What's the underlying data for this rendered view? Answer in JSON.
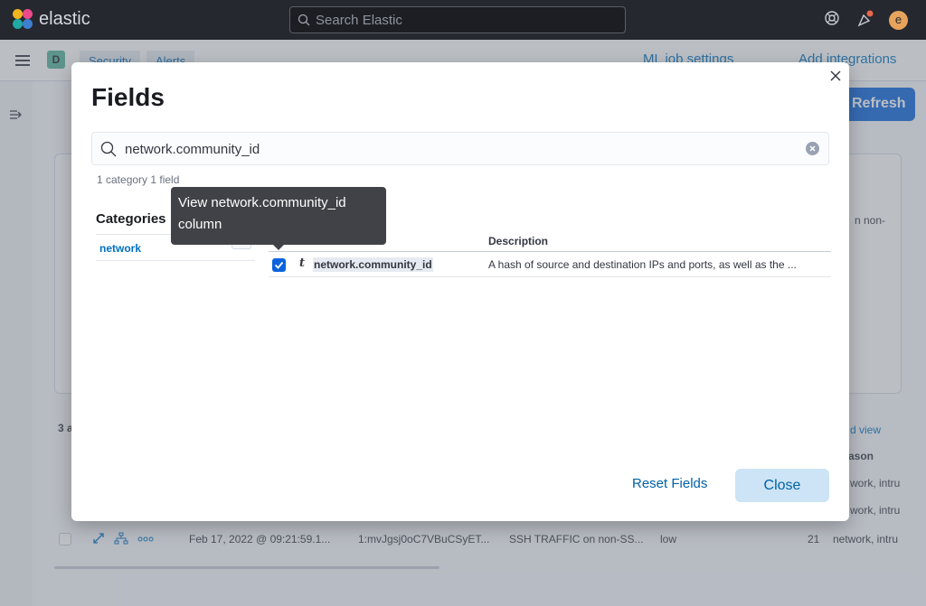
{
  "header": {
    "app_name": "elastic",
    "search_placeholder": "Search Elastic",
    "avatar_initial": "e"
  },
  "subheader": {
    "space_initial": "D",
    "breadcrumbs": [
      "Security",
      "Alerts"
    ],
    "ml_job_settings": "ML job settings",
    "add_integrations": "Add integrations"
  },
  "background": {
    "refresh_label": "Refresh",
    "count_prefix": "3 a",
    "view_link": "d view",
    "column_reason": "ason",
    "partial_text": "n non-",
    "row_date": "Feb 17, 2022 @ 09:21:59.1...",
    "row_id": "1:mvJgsj0oC7VBuCSyET...",
    "row_rule": "SSH TRAFFIC on non-SS...",
    "row_severity": "low",
    "row_score": "21",
    "row_reason": "network, intru",
    "reason_1": "work, intru",
    "reason_2": "work, intru"
  },
  "modal": {
    "title": "Fields",
    "search_value": "network.community_id",
    "search_count": "1 category 1 field",
    "categories_title": "Categories",
    "categories": [
      {
        "name": "network",
        "count": "1"
      }
    ],
    "table": {
      "description_header": "Description",
      "rows": [
        {
          "checked": true,
          "type_icon": "t",
          "field": "network.community_id",
          "description": "A hash of source and destination IPs and ports, as well as the ..."
        }
      ]
    },
    "tooltip": "View network.community_id column",
    "reset_label": "Reset Fields",
    "close_label": "Close"
  }
}
